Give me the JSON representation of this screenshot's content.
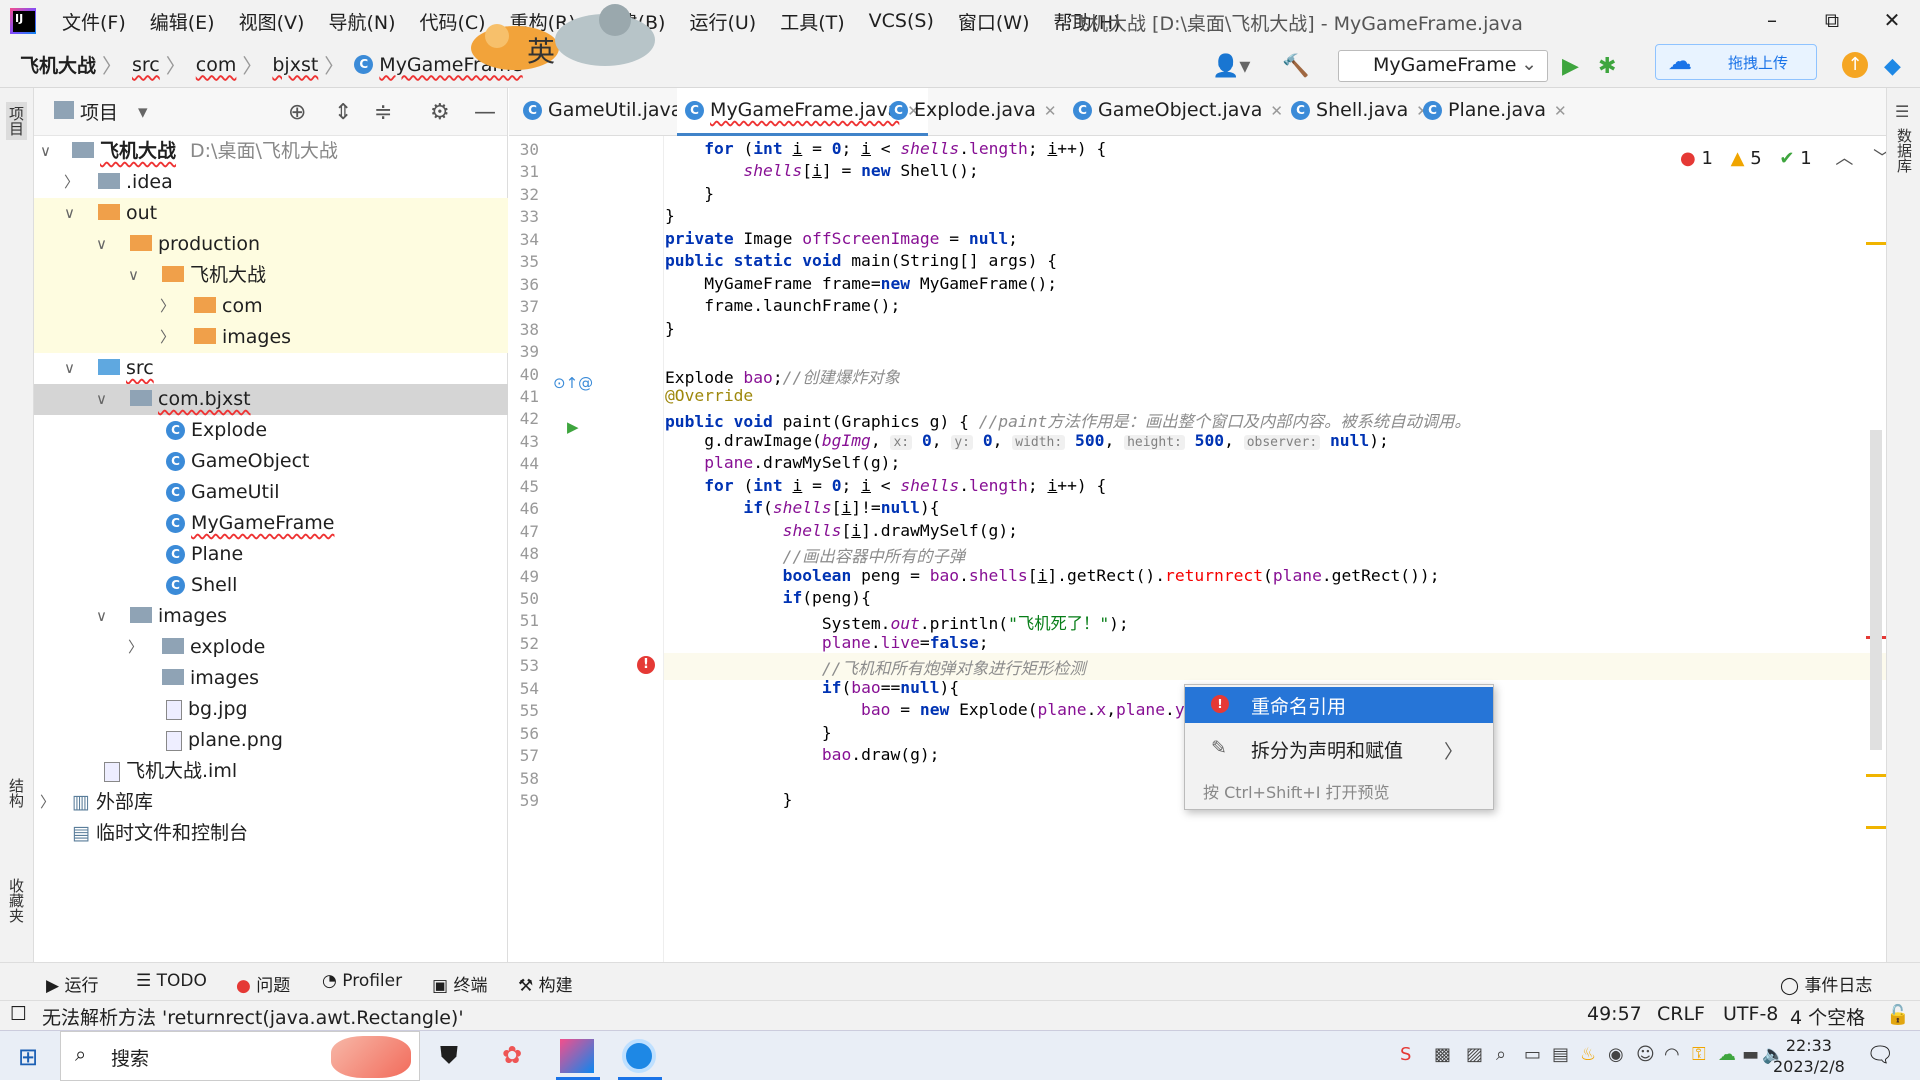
{
  "menu": [
    "文件(F)",
    "编辑(E)",
    "视图(V)",
    "导航(N)",
    "代码(C)",
    "重构(R)",
    "构建(B)",
    "运行(U)",
    "工具(T)",
    "VCS(S)",
    "窗口(W)",
    "帮助(H)"
  ],
  "window_title": "飞机大战 [D:\\桌面\\飞机大战] - MyGameFrame.java",
  "window_buttons": {
    "minimize": "–",
    "restore": "⧉",
    "close": "✕"
  },
  "breadcrumb": [
    "飞机大战",
    "src",
    "com",
    "bjxst",
    "MyGameFrame"
  ],
  "run_config": "MyGameFrame",
  "upload_label": "拖拽上传",
  "ime_char": "英",
  "left_strip": {
    "project": "项目",
    "structure": "结构",
    "favorites": "收藏夹"
  },
  "right_strip": {
    "database": "数据库"
  },
  "project_panel": {
    "title": "项目"
  },
  "tree": [
    {
      "label": "飞机大战",
      "path": "D:\\桌面\\飞机大战",
      "icon": "gray"
    },
    {
      "label": ".idea",
      "icon": "gray"
    },
    {
      "label": "out",
      "icon": "orange"
    },
    {
      "label": "production",
      "icon": "orange"
    },
    {
      "label": "飞机大战",
      "icon": "orange"
    },
    {
      "label": "com",
      "icon": "orange"
    },
    {
      "label": "images",
      "icon": "orange"
    },
    {
      "label": "src",
      "icon": "blue"
    },
    {
      "label": "com.bjxst",
      "icon": "gray"
    },
    {
      "label": "Explode",
      "icon": "class"
    },
    {
      "label": "GameObject",
      "icon": "class"
    },
    {
      "label": "GameUtil",
      "icon": "class"
    },
    {
      "label": "MyGameFrame",
      "icon": "class"
    },
    {
      "label": "Plane",
      "icon": "class"
    },
    {
      "label": "Shell",
      "icon": "class"
    },
    {
      "label": "images",
      "icon": "gray"
    },
    {
      "label": "explode",
      "icon": "gray"
    },
    {
      "label": "images",
      "icon": "gray"
    },
    {
      "label": "bg.jpg",
      "icon": "file"
    },
    {
      "label": "plane.png",
      "icon": "file"
    },
    {
      "label": "飞机大战.iml",
      "icon": "file"
    },
    {
      "label": "外部库",
      "icon": "lib"
    },
    {
      "label": "临时文件和控制台",
      "icon": "scratch"
    }
  ],
  "tabs": [
    "GameUtil.java",
    "MyGameFrame.java",
    "Explode.java",
    "GameObject.java",
    "Shell.java",
    "Plane.java"
  ],
  "active_tab": "MyGameFrame.java",
  "inspections": {
    "errors": "1",
    "warnings": "5",
    "ok": "1"
  },
  "line_numbers": [
    "30",
    "31",
    "32",
    "33",
    "34",
    "35",
    "36",
    "37",
    "38",
    "39",
    "40",
    "41",
    "42",
    "43",
    "44",
    "45",
    "46",
    "47",
    "48",
    "49",
    "50",
    "51",
    "52",
    "53",
    "54",
    "55",
    "56",
    "57",
    "58",
    "59"
  ],
  "code_text": {
    "l40_comment": "//创建爆炸对象",
    "l42_comment": "//paint方法作用是：画出整个窗口及内部内容。被系统自动调用。",
    "l48_comment": "//画出容器中所有的子弹",
    "l51_string": "\"飞机死了！\"",
    "l53_comment": "//飞机和所有炮弹对象进行矩形检测",
    "hint_x": "x:",
    "hint_y": "y:",
    "hint_width": "width:",
    "hint_height": "height:",
    "hint_observer": "observer:"
  },
  "popup": {
    "items": [
      "重命名引用",
      "拆分为声明和赋值"
    ],
    "hint": "按 Ctrl+Shift+I 打开预览"
  },
  "toolwindows": [
    "运行",
    "TODO",
    "问题",
    "Profiler",
    "终端",
    "构建"
  ],
  "event_log": "事件日志",
  "status": {
    "message": "无法解析方法 'returnrect(java.awt.Rectangle)'",
    "position": "49:57",
    "line_sep": "CRLF",
    "encoding": "UTF-8",
    "indent": "4 个空格"
  },
  "taskbar": {
    "search": "搜索",
    "time": "22:33",
    "date": "2023/2/8"
  },
  "colors": {
    "accent": "#2675d7",
    "keyword": "#0033b3",
    "field": "#871094",
    "string": "#067d17",
    "comment": "#8c8c8c",
    "error": "#e53935"
  }
}
